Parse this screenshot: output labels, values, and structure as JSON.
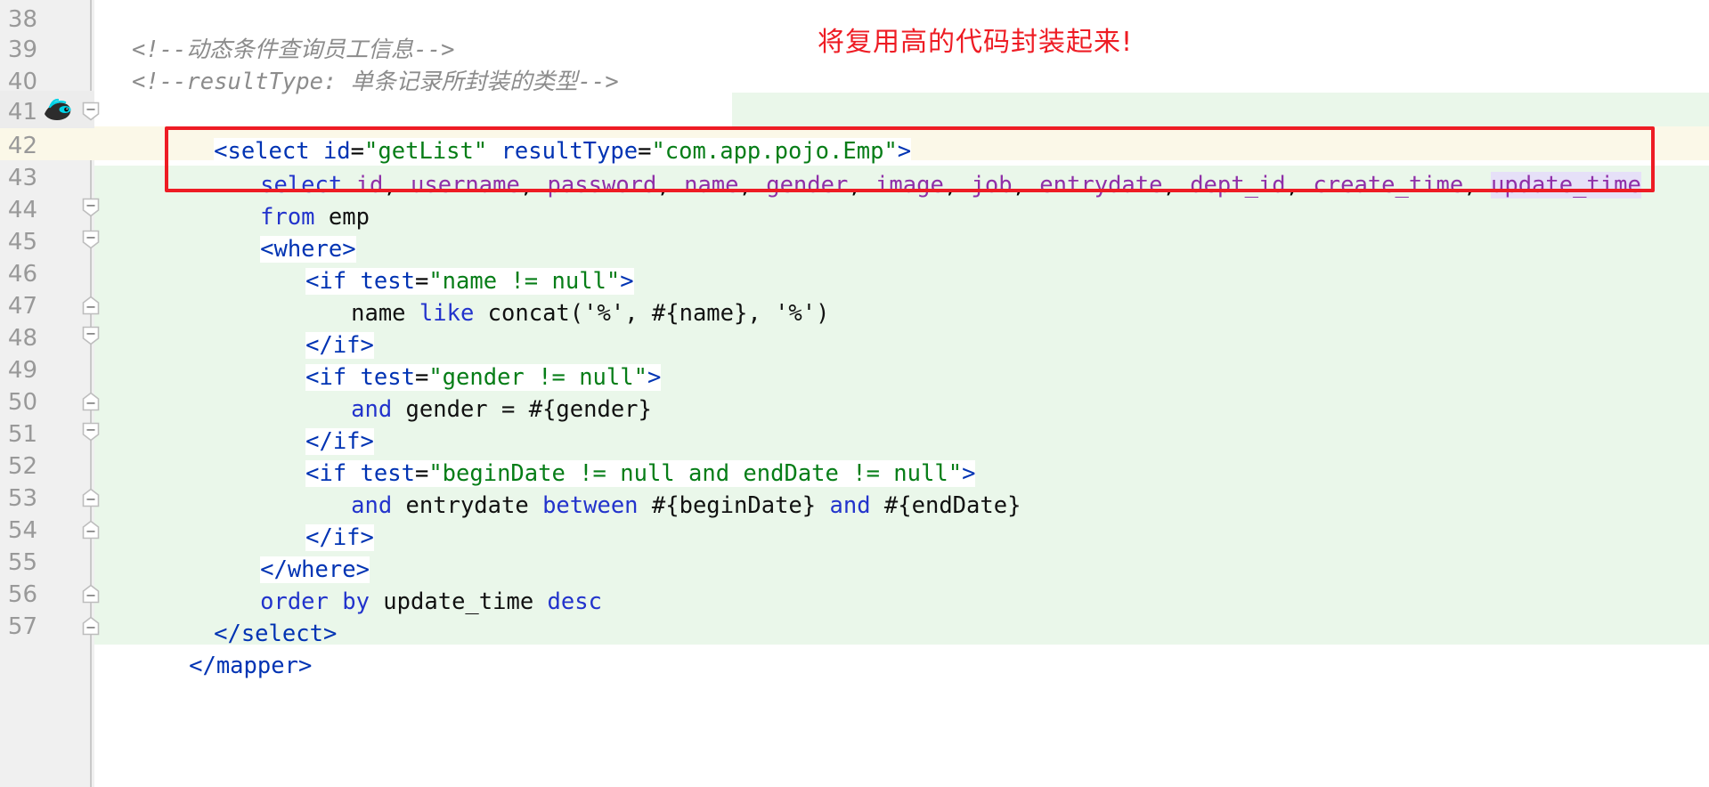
{
  "editor": {
    "language": "xml-mybatis-mapper",
    "annotation_text": "将复用高的代码封装起来!",
    "annotation_color": "#ee1c24",
    "highlight_box_color": "#ee1c24",
    "caret_line": 42,
    "selection_highlight_word": "update_time",
    "gutter_icon": "mybatis-bird-icon"
  },
  "lines": [
    {
      "no": "38",
      "text": ""
    },
    {
      "no": "39",
      "text": "    <!--动态条件查询员工信息-->"
    },
    {
      "no": "40",
      "text": "    <!--resultType: 单条记录所封装的类型-->"
    },
    {
      "no": "41",
      "text": "    <select id=\"getList\" resultType=\"com.app.pojo.Emp\">"
    },
    {
      "no": "42",
      "text": "        select id, username, password, name, gender, image, job, entrydate, dept_id, create_time, update_time"
    },
    {
      "no": "43",
      "text": "        from emp"
    },
    {
      "no": "44",
      "text": "        <where>"
    },
    {
      "no": "45",
      "text": "            <if test=\"name != null\">"
    },
    {
      "no": "46",
      "text": "                name like concat('%', #{name}, '%')"
    },
    {
      "no": "47",
      "text": "            </if>"
    },
    {
      "no": "48",
      "text": "            <if test=\"gender != null\">"
    },
    {
      "no": "49",
      "text": "                and gender = #{gender}"
    },
    {
      "no": "50",
      "text": "            </if>"
    },
    {
      "no": "51",
      "text": "            <if test=\"beginDate != null and endDate != null\">"
    },
    {
      "no": "52",
      "text": "                and entrydate between #{beginDate} and #{endDate}"
    },
    {
      "no": "53",
      "text": "            </if>"
    },
    {
      "no": "54",
      "text": "        </where>"
    },
    {
      "no": "55",
      "text": "        order by update_time desc"
    },
    {
      "no": "56",
      "text": "    </select>"
    },
    {
      "no": "57",
      "text": "</mapper>"
    }
  ],
  "line_numbers": {
    "n38": "38",
    "n39": "39",
    "n40": "40",
    "n41": "41",
    "n42": "42",
    "n43": "43",
    "n44": "44",
    "n45": "45",
    "n46": "46",
    "n47": "47",
    "n48": "48",
    "n49": "49",
    "n50": "50",
    "n51": "51",
    "n52": "52",
    "n53": "53",
    "n54": "54",
    "n55": "55",
    "n56": "56",
    "n57": "57"
  },
  "tokens": {
    "comment39": "<!--动态条件查询员工信息-->",
    "comment40": "<!--resultType: 单条记录所封装的类型-->",
    "l41_lt_select": "<select",
    "l41_sp1": " ",
    "l41_attr_id": "id",
    "l41_eq1": "=",
    "l41_val_id": "\"getList\"",
    "l41_sp2": " ",
    "l41_attr_rt": "resultType",
    "l41_eq2": "=",
    "l41_val_rt": "\"com.app.pojo.Emp\"",
    "l41_gt": ">",
    "l42_select": "select",
    "l42_id": " id",
    "l42_c1": ",",
    "l42_username": " username",
    "l42_c2": ",",
    "l42_password": " password",
    "l42_c3": ",",
    "l42_name": " name",
    "l42_c4": ",",
    "l42_gender": " gender",
    "l42_c5": ",",
    "l42_image": " image",
    "l42_c6": ",",
    "l42_job": " job",
    "l42_c7": ",",
    "l42_entrydate": " entrydate",
    "l42_c8": ",",
    "l42_deptid": " dept_id",
    "l42_c9": ",",
    "l42_createtime": " create_time",
    "l42_c10": ",",
    "l42_updatetime": "update_time",
    "l43_from": "from",
    "l43_emp": " emp",
    "l44_where": "<where>",
    "l45_if_lt": "<if",
    "l45_test": " test",
    "l45_eq": "=",
    "l45_val": "\"name != null\"",
    "l45_gt": ">",
    "l46_name": "name",
    "l46_like": " like",
    "l46_rest": " concat('%', #{name}, '%')",
    "l47_endif": "</if>",
    "l48_if_lt": "<if",
    "l48_test": " test",
    "l48_eq": "=",
    "l48_val": "\"gender != null\"",
    "l48_gt": ">",
    "l49_and": "and",
    "l49_rest": " gender = #{gender}",
    "l50_endif": "</if>",
    "l51_if_lt": "<if",
    "l51_test": " test",
    "l51_eq": "=",
    "l51_val": "\"beginDate != null and endDate != null\"",
    "l51_gt": ">",
    "l52_and": "and",
    "l52_entrydate": " entrydate",
    "l52_between": " between",
    "l52_p1": " #{beginDate}",
    "l52_and2": " and",
    "l52_p2": " #{endDate}",
    "l53_endif": "</if>",
    "l54_endwhere": "</where>",
    "l55_order": "order",
    "l55_by": " by",
    "l55_col": " update_time",
    "l55_desc": " desc",
    "l56_endselect": "</select>",
    "l57_endmapper": "</mapper>"
  }
}
